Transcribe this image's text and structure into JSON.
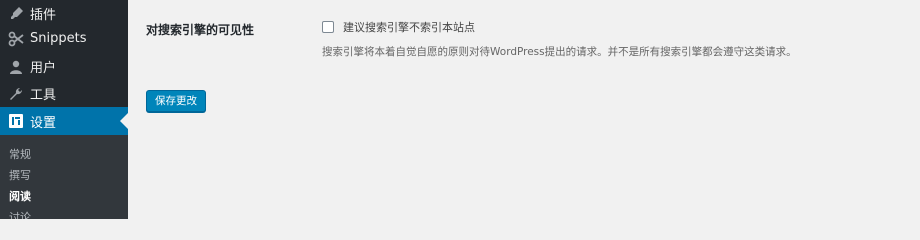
{
  "sidebar": {
    "items": [
      {
        "label": "插件",
        "icon": "plugin-icon"
      },
      {
        "label": "Snippets",
        "icon": "snippets-icon"
      },
      {
        "label": "用户",
        "icon": "user-icon"
      },
      {
        "label": "工具",
        "icon": "wrench-icon"
      },
      {
        "label": "设置",
        "icon": "settings-icon",
        "active": true
      }
    ],
    "submenu": [
      {
        "label": "常规"
      },
      {
        "label": "撰写"
      },
      {
        "label": "阅读",
        "current": true
      },
      {
        "label": "讨论"
      }
    ]
  },
  "settings": {
    "field_label": "对搜索引擎的可见性",
    "checkbox_label": "建议搜索引擎不索引本站点",
    "checkbox_checked": false,
    "description": "搜索引擎将本着自觉自愿的原则对待WordPress提出的请求。并不是所有搜索引擎都会遵守这类请求。"
  },
  "save_button": "保存更改",
  "colors": {
    "sidebar_bg": "#23282d",
    "submenu_bg": "#32373c",
    "accent": "#0073aa",
    "button": "#0085ba",
    "page_bg": "#f1f1f1"
  }
}
